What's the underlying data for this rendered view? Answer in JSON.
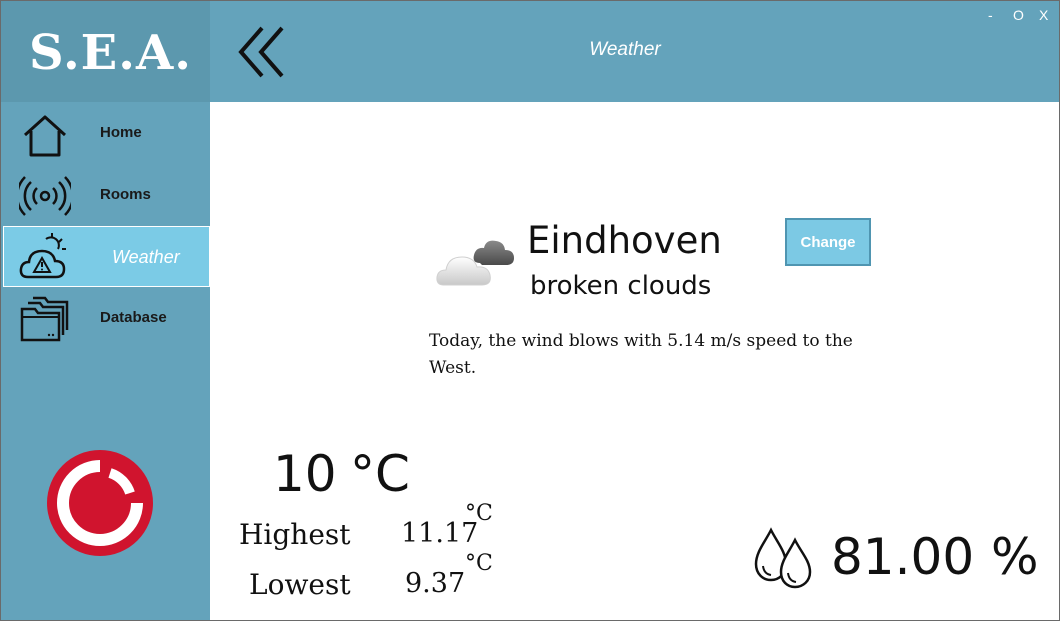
{
  "app": {
    "logo": "S.E.A."
  },
  "header": {
    "title": "Weather",
    "min_label": "-",
    "max_label": "O",
    "close_label": "X"
  },
  "sidebar": {
    "items": [
      {
        "label": "Home",
        "icon": "home-icon"
      },
      {
        "label": "Rooms",
        "icon": "signal-icon"
      },
      {
        "label": "Weather",
        "icon": "weather-alert-icon"
      },
      {
        "label": "Database",
        "icon": "folders-icon"
      }
    ],
    "active": "Weather"
  },
  "weather": {
    "city": "Eindhoven",
    "description": "broken clouds",
    "change_label": "Change",
    "wind_text": "Today, the wind blows with 5.14 m/s speed to the West.",
    "temperature": "10",
    "temperature_unit": "°C",
    "highest_label": "Highest",
    "highest_value": "11.17",
    "lowest_label": "Lowest",
    "lowest_value": "9.37",
    "minmax_unit": "°C",
    "humidity": "81.00",
    "humidity_unit": "%"
  },
  "colors": {
    "primary": "#64a3bb",
    "logo_bg": "#5c98ae",
    "active": "#7bcbe6",
    "accent": "#d0142e"
  }
}
